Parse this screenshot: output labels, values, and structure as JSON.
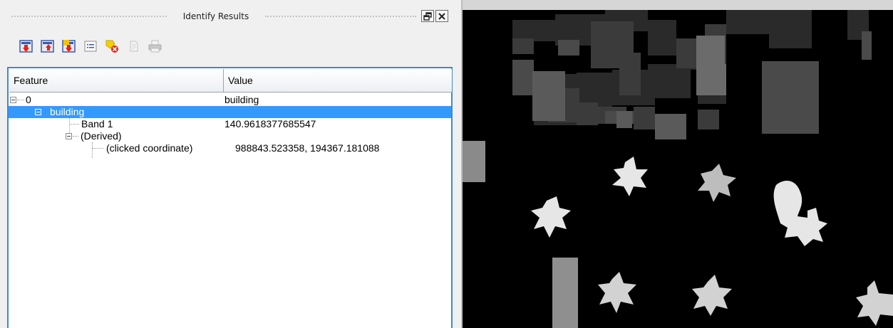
{
  "panel": {
    "title": "Identify Results",
    "buttons": {
      "float_icon": "float-window-icon",
      "close_icon": "close-icon"
    }
  },
  "toolbar": [
    {
      "name": "expand-tree-button",
      "icon": "expand-tree-icon"
    },
    {
      "name": "collapse-tree-button",
      "icon": "collapse-tree-icon"
    },
    {
      "name": "expand-new-results-button",
      "icon": "expand-new-icon"
    },
    {
      "name": "open-form-button",
      "icon": "form-icon"
    },
    {
      "name": "clear-highlights-button",
      "icon": "deselect-icon"
    },
    {
      "name": "copy-button",
      "icon": "copy-icon"
    },
    {
      "name": "print-button",
      "icon": "print-icon"
    }
  ],
  "tree": {
    "columns": [
      "Feature",
      "Value"
    ],
    "rows": [
      {
        "feature": "0",
        "value": "building"
      },
      {
        "feature": "building",
        "value": ""
      },
      {
        "feature": "Band 1",
        "value": "140.9618377685547"
      },
      {
        "feature": "(Derived)",
        "value": ""
      },
      {
        "feature": "(clicked coordinate)",
        "value": "988843.523358, 194367.181088"
      }
    ]
  },
  "colors": {
    "selection": "#3399ff",
    "focus_border": "#3f88d6"
  }
}
